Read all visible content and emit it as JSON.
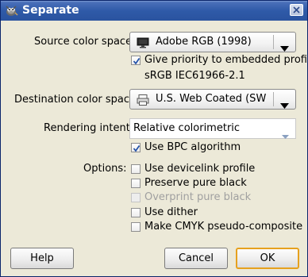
{
  "window": {
    "title": "Separate",
    "icon": "gimp-wilber-icon"
  },
  "source": {
    "label": "Source color space:",
    "value": "Adobe RGB (1998)",
    "icon": "monitor-icon"
  },
  "embedded": {
    "checkbox_label": "Give priority to embedded profile",
    "checked": true,
    "profile_name": "sRGB IEC61966-2.1"
  },
  "destination": {
    "label": "Destination color space:",
    "value": "U.S. Web Coated (SWO…",
    "icon": "printer-icon"
  },
  "intent": {
    "label": "Rendering intent:",
    "value": "Relative colorimetric"
  },
  "bpc": {
    "label": "Use BPC algorithm",
    "checked": true
  },
  "options": {
    "label": "Options:",
    "items": [
      {
        "label": "Use devicelink profile",
        "checked": false,
        "enabled": true
      },
      {
        "label": "Preserve pure black",
        "checked": false,
        "enabled": true
      },
      {
        "label": "Overprint pure black",
        "checked": false,
        "enabled": false
      },
      {
        "label": "Use dither",
        "checked": false,
        "enabled": true
      },
      {
        "label": "Make CMYK pseudo-composite",
        "checked": false,
        "enabled": true
      }
    ]
  },
  "buttons": {
    "help": "Help",
    "cancel": "Cancel",
    "ok": "OK"
  },
  "colors": {
    "titlebar": "#2f5aa8",
    "dialog_bg": "#ece9d8",
    "default_button_border": "#e6a11e"
  }
}
